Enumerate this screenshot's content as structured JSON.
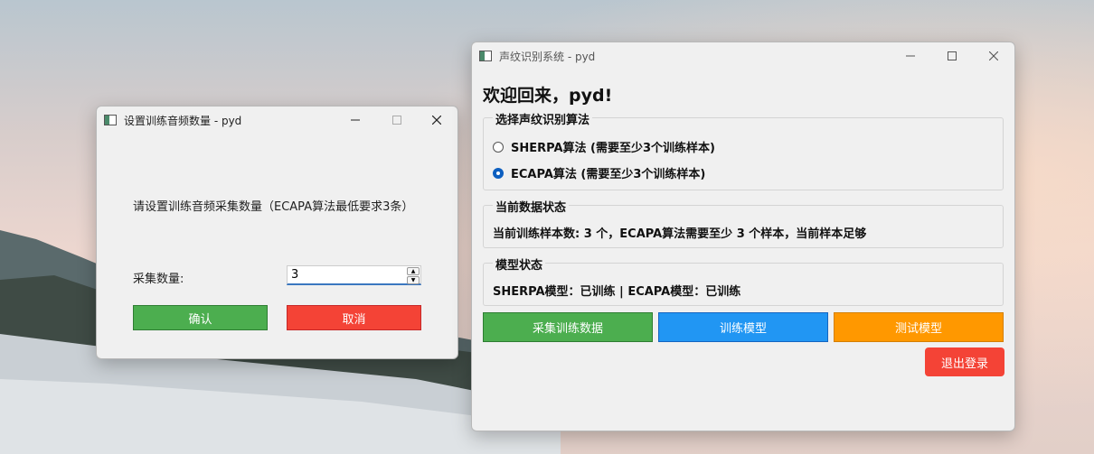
{
  "dialog": {
    "title": "设置训练音频数量 - pyd",
    "prompt": "请设置训练音频采集数量（ECAPA算法最低要求3条）",
    "quantity_label": "采集数量:",
    "quantity_value": "3",
    "confirm_label": "确认",
    "cancel_label": "取消"
  },
  "main": {
    "title": "声纹识别系统 - pyd",
    "welcome": "欢迎回来，pyd!",
    "algo_group_title": "选择声纹识别算法",
    "algo_options": [
      {
        "label": "SHERPA算法 (需要至少3个训练样本)",
        "checked": false
      },
      {
        "label": "ECAPA算法 (需要至少3个训练样本)",
        "checked": true
      }
    ],
    "data_group_title": "当前数据状态",
    "data_status": "当前训练样本数: 3 个，ECAPA算法需要至少 3 个样本，当前样本足够",
    "model_group_title": "模型状态",
    "model_status": "SHERPA模型：已训练 | ECAPA模型：已训练",
    "buttons": {
      "collect": "采集训练数据",
      "train": "训练模型",
      "test": "测试模型",
      "logout": "退出登录"
    }
  },
  "colors": {
    "green": "#4cae4f",
    "blue": "#2196f3",
    "orange": "#ff9800",
    "red": "#f44336"
  }
}
